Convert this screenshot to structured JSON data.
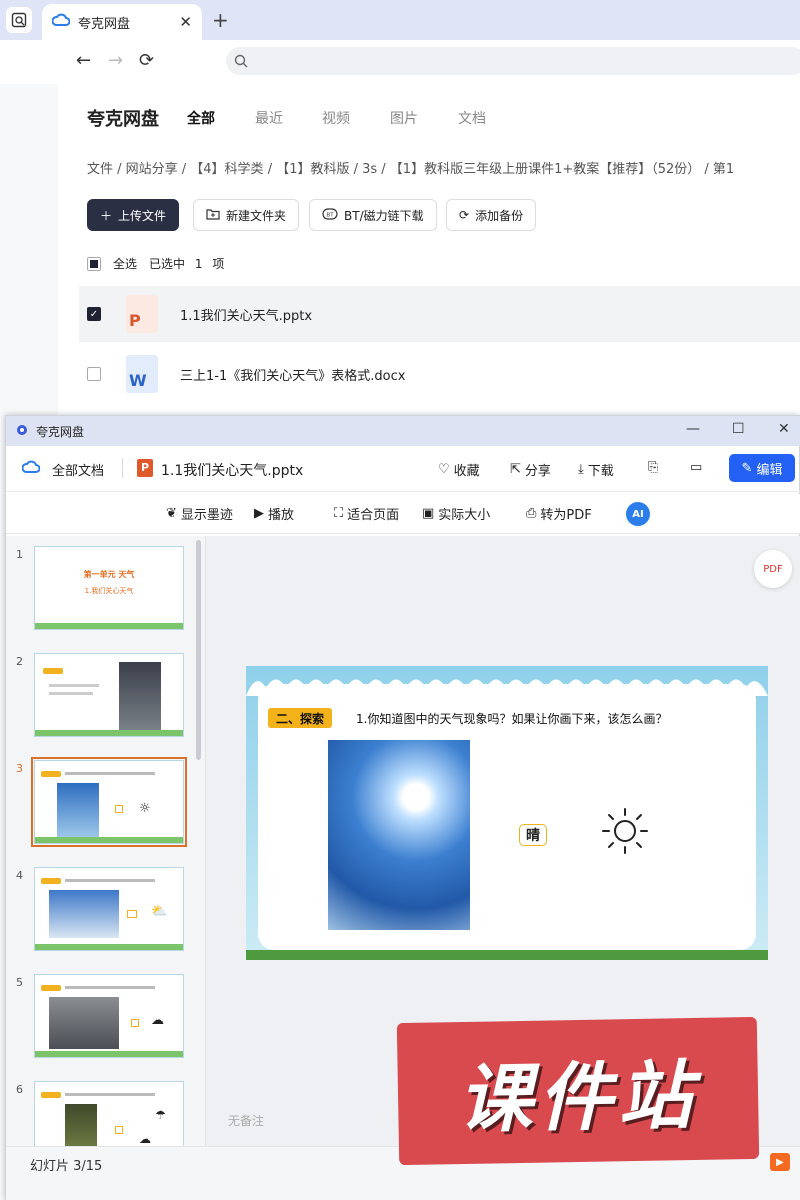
{
  "browser": {
    "tab_title": "夸克网盘",
    "address": ""
  },
  "header": {
    "brand": "夸克网盘",
    "tabs": [
      "全部",
      "最近",
      "视频",
      "图片",
      "文档"
    ]
  },
  "breadcrumb": "文件 / 网站分享 / 【4】科学类 / 【1】教科版 / 3s / 【1】教科版三年级上册课件1+教案【推荐】（52份） / 第1",
  "actions": {
    "upload": "上传文件",
    "new_folder": "新建文件夹",
    "bt_download": "BT/磁力链下载",
    "add_backup": "添加备份"
  },
  "selection": {
    "select_all": "全选",
    "selected": "已选中",
    "count": "1",
    "unit": "项"
  },
  "files": [
    {
      "name": "1.1我们关心天气.pptx",
      "type": "pptx",
      "selected": true
    },
    {
      "name": "三上1-1《我们关心天气》表格式.docx",
      "type": "docx",
      "selected": false
    }
  ],
  "viewer": {
    "window_title": "夸克网盘",
    "all_docs": "全部文档",
    "file_name": "1.1我们关心天气.pptx",
    "collect": "收藏",
    "share": "分享",
    "download": "下载",
    "edit": "编辑",
    "tools": {
      "show_ink": "显示墨迹",
      "play": "播放",
      "fit_page": "适合页面",
      "actual_size": "实际大小",
      "to_pdf": "转为PDF"
    },
    "thumbs": [
      {
        "num": "1",
        "title": "第一单元    天气",
        "subtitle": "1.我们关心天气"
      },
      {
        "num": "2"
      },
      {
        "num": "3"
      },
      {
        "num": "4"
      },
      {
        "num": "5"
      },
      {
        "num": "6"
      }
    ],
    "slide": {
      "tag": "二、探索",
      "question": "1.你知道图中的天气现象吗？如果让你画下来，该怎么画？",
      "label": "晴"
    },
    "notes": "无备注",
    "status": "幻灯片 3/15"
  },
  "watermark": "课件站"
}
